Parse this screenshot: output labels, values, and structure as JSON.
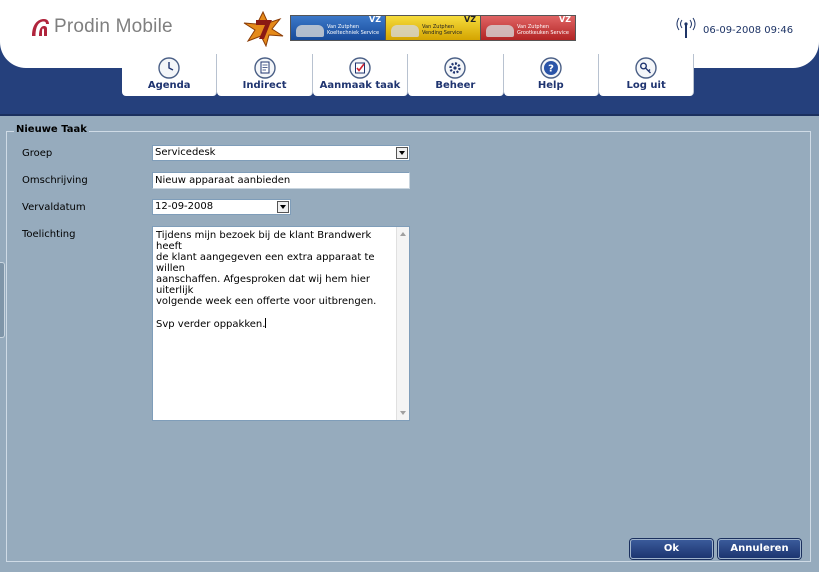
{
  "app": {
    "logo_text": "Prodin Mobile",
    "datetime": "06-09-2008 09:46"
  },
  "banners": [
    {
      "line1": "Van Zutphen",
      "line2": "Koeltechniek Service",
      "mark": "VZ"
    },
    {
      "line1": "Van Zutphen",
      "line2": "Vending Service",
      "mark": "VZ"
    },
    {
      "line1": "Van Zutphen",
      "line2": "Grootkeuken Service",
      "mark": "VZ"
    }
  ],
  "nav": [
    {
      "label": "Agenda",
      "icon": "clock-icon"
    },
    {
      "label": "Indirect",
      "icon": "document-icon"
    },
    {
      "label": "Aanmaak taak",
      "icon": "checklist-icon"
    },
    {
      "label": "Beheer",
      "icon": "gear-icon"
    },
    {
      "label": "Help",
      "icon": "help-icon"
    },
    {
      "label": "Log uit",
      "icon": "key-icon"
    }
  ],
  "form": {
    "legend": "Nieuwe Taak",
    "groep_label": "Groep",
    "groep_value": "Servicedesk",
    "omschrijving_label": "Omschrijving",
    "omschrijving_value": "Nieuw apparaat aanbieden",
    "vervaldatum_label": "Vervaldatum",
    "vervaldatum_value": "12-09-2008",
    "toelichting_label": "Toelichting",
    "toelichting_value": "Tijdens mijn bezoek bij de klant Brandwerk heeft\nde klant aangegeven een extra apparaat te willen\naanschaffen. Afgesproken dat wij hem hier uiterlijk\nvolgende week een offerte voor uitbrengen.\n\nSvp verder oppakken."
  },
  "buttons": {
    "ok": "Ok",
    "cancel": "Annuleren"
  },
  "colors": {
    "header_blue": "#25407c",
    "page_bg": "#96abbd",
    "nav_text": "#1f3470"
  }
}
